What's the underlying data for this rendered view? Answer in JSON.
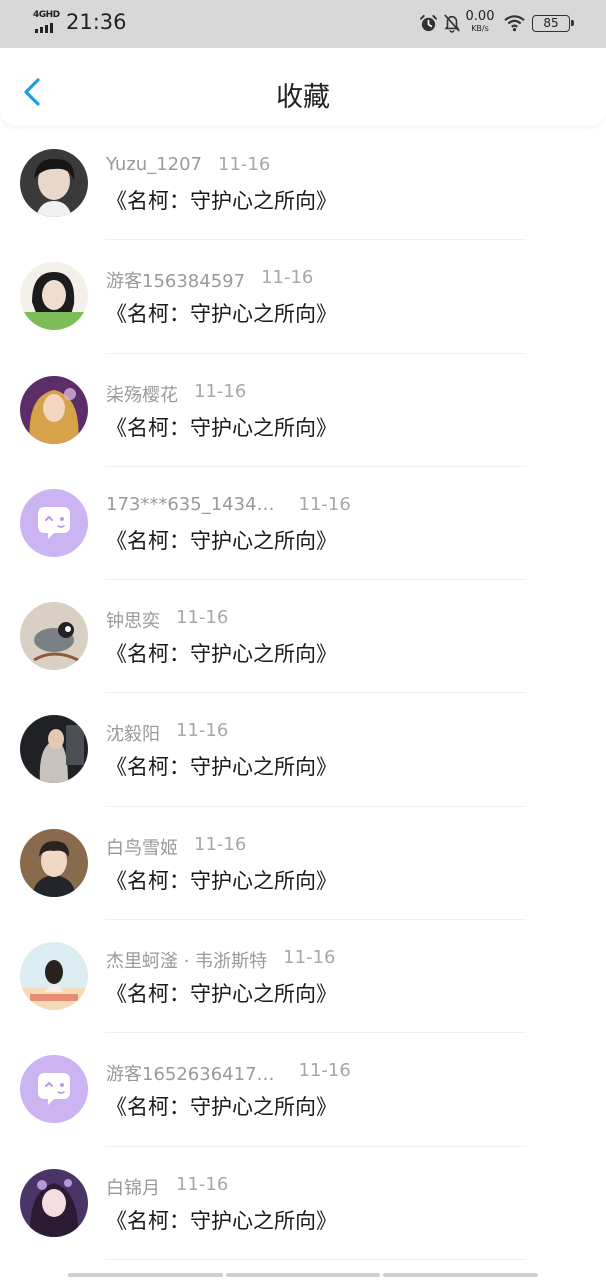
{
  "status_bar": {
    "network": "4GHD",
    "time": "21:36",
    "speed_value": "0.00",
    "speed_unit": "KB/s",
    "battery": "85",
    "icons": [
      "signal-icon",
      "alarm-icon",
      "mute-bell-icon",
      "wifi-icon",
      "battery-icon"
    ]
  },
  "header": {
    "back_icon": "chevron-left-icon",
    "title": "收藏",
    "accent_color": "#1e9be6"
  },
  "favorites": [
    {
      "user": "Yuzu_1207",
      "date": "11-16",
      "book": "《名柯：守护心之所向》",
      "avatar": "photo"
    },
    {
      "user": "游客156384597",
      "date": "11-16",
      "book": "《名柯：守护心之所向》",
      "avatar": "photo"
    },
    {
      "user": "柒殇樱花",
      "date": "11-16",
      "book": "《名柯：守护心之所向》",
      "avatar": "photo"
    },
    {
      "user": "173***635_1434…",
      "date": "11-16",
      "book": "《名柯：守护心之所向》",
      "avatar": "default-chat-icon"
    },
    {
      "user": "钟思奕",
      "date": "11-16",
      "book": "《名柯：守护心之所向》",
      "avatar": "photo"
    },
    {
      "user": "沈毅阳",
      "date": "11-16",
      "book": "《名柯：守护心之所向》",
      "avatar": "photo"
    },
    {
      "user": "白鸟雪姬",
      "date": "11-16",
      "book": "《名柯：守护心之所向》",
      "avatar": "photo"
    },
    {
      "user": "杰里蚵滏 · 韦浙斯特",
      "date": "11-16",
      "book": "《名柯：守护心之所向》",
      "avatar": "photo"
    },
    {
      "user": "游客1652636417…",
      "date": "11-16",
      "book": "《名柯：守护心之所向》",
      "avatar": "default-chat-icon"
    },
    {
      "user": "白锦月",
      "date": "11-16",
      "book": "《名柯：守护心之所向》",
      "avatar": "photo"
    }
  ]
}
